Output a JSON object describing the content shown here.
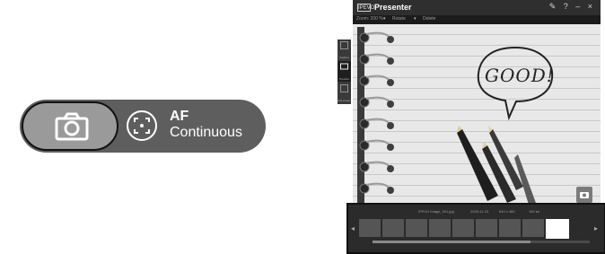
{
  "capture_pill": {
    "camera_icon": "camera-icon",
    "af_icon": "autofocus-icon",
    "af_title": "AF",
    "af_mode": "Continuous"
  },
  "presenter": {
    "logo_text": "IPEVO",
    "title": "Presenter",
    "window_controls": "✎ ? – ×",
    "toolbar": {
      "items": [
        "Zoom: 200 %",
        "Rotate",
        "Delete"
      ]
    },
    "side_panel": {
      "items": [
        {
          "label": "Capture",
          "icon": "capture-icon"
        },
        {
          "label": "Preview",
          "icon": "preview-icon"
        },
        {
          "label": "Full screen",
          "icon": "fullscreen-icon"
        }
      ]
    },
    "live_view": {
      "handwriting": "GOOD!"
    },
    "filmstrip": {
      "file_name": "IPEVO Image_001.jpg",
      "date": "2009-11-23",
      "resolution": "640 x 480",
      "size": "180 kb",
      "thumbnail_count": 9,
      "scroll_position_fraction": 0.73
    }
  },
  "colors": {
    "pill_dark": "#5e5e5e",
    "pill_light": "#9a9a9a",
    "window_bg": "#2b2b2b"
  }
}
